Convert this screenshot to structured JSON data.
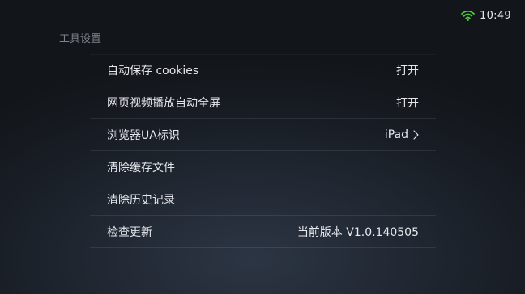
{
  "status_bar": {
    "time": "10:49",
    "wifi_icon": "wifi-icon",
    "wifi_color": "#4cd137"
  },
  "section_title": "工具设置",
  "settings": [
    {
      "label": "自动保存 cookies",
      "value": "打开"
    },
    {
      "label": "网页视频播放自动全屏",
      "value": "打开"
    },
    {
      "label": "浏览器UA标识",
      "value": "iPad",
      "icon": "chevron-right-icon"
    },
    {
      "label": "清除缓存文件",
      "value": ""
    },
    {
      "label": "清除历史记录",
      "value": ""
    },
    {
      "label": "检查更新",
      "value": "当前版本 V1.0.140505"
    }
  ]
}
